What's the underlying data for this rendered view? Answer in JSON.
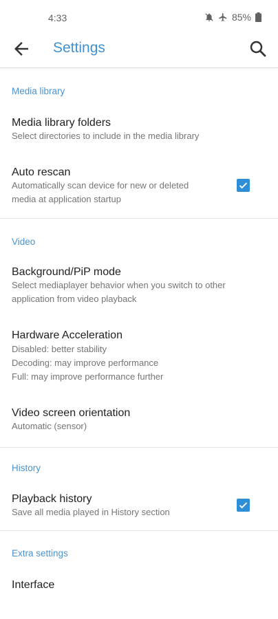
{
  "status": {
    "time": "4:33",
    "battery": "85%",
    "icons": [
      "bell-off-icon",
      "airplane-icon",
      "battery-icon"
    ]
  },
  "appbar": {
    "title": "Settings",
    "back_icon": "arrow-left-icon",
    "search_icon": "search-icon"
  },
  "sections": {
    "media_library": {
      "title": "Media library",
      "folders": {
        "title": "Media library folders",
        "summary": "Select directories to include in the media library"
      },
      "auto_rescan": {
        "title": "Auto rescan",
        "summary_line1": "Automatically scan device for new or deleted",
        "summary_line2": "media at application startup",
        "checked": true
      }
    },
    "video": {
      "title": "Video",
      "background_pip": {
        "title": "Background/PiP mode",
        "summary_line1": "Select mediaplayer behavior when you switch to other",
        "summary_line2": "application from video playback"
      },
      "hw_accel": {
        "title": "Hardware Acceleration",
        "summary_line1": "Disabled: better stability",
        "summary_line2": "Decoding: may improve performance",
        "summary_line3": "Full: may improve performance further"
      },
      "orientation": {
        "title": "Video screen orientation",
        "summary": "Automatic (sensor)"
      }
    },
    "history": {
      "title": "History",
      "playback_history": {
        "title": "Playback history",
        "summary": "Save all media played in History section",
        "checked": true
      }
    },
    "extra": {
      "title": "Extra settings",
      "interface": {
        "title": "Interface"
      }
    }
  },
  "colors": {
    "accent": "#3f91d1",
    "checkbox": "#2f8fd6",
    "summary_text": "#757575"
  }
}
